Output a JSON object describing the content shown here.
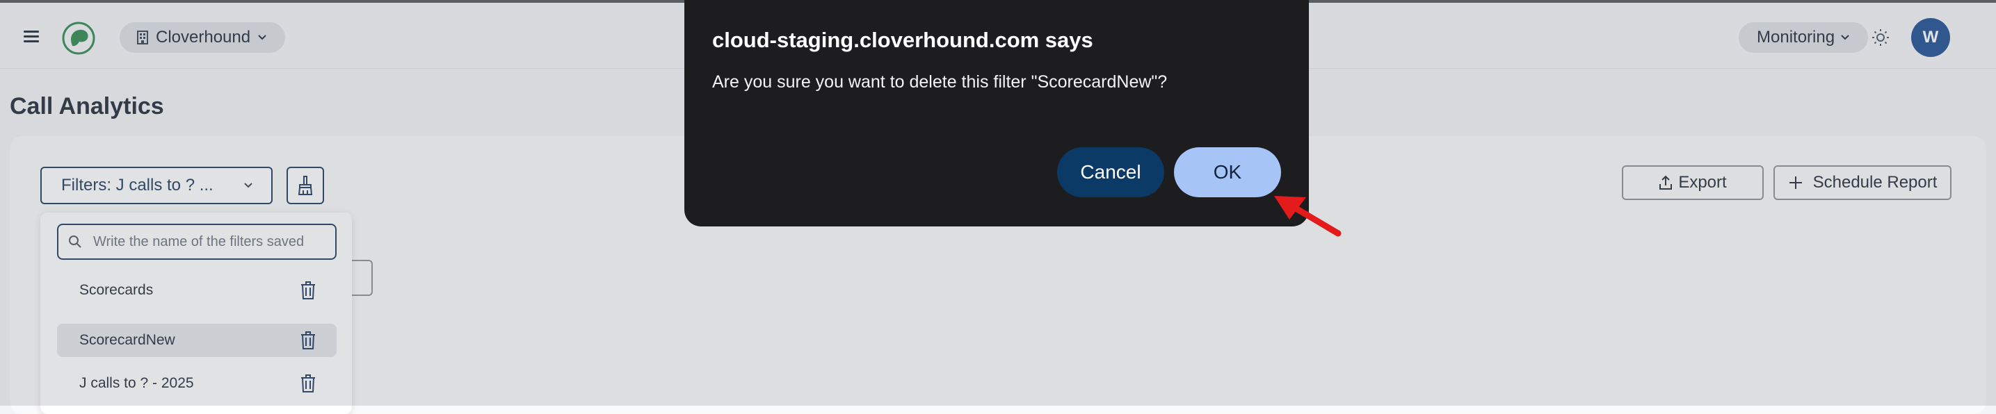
{
  "header": {
    "org_name": "Cloverhound",
    "monitoring_label": "Monitoring",
    "avatar_initial": "W"
  },
  "page": {
    "title": "Call Analytics"
  },
  "filters": {
    "select_label": "Filters: J calls to ? ...",
    "search_placeholder": "Write the name of the filters saved",
    "items": [
      {
        "label": "Scorecards"
      },
      {
        "label": "ScorecardNew"
      },
      {
        "label": "J calls to ? - 2025"
      }
    ]
  },
  "toolbar": {
    "export_label": "Export",
    "schedule_label": "Schedule Report"
  },
  "dialog": {
    "title": "cloud-staging.cloverhound.com says",
    "message": "Are you sure you want to delete this filter \"ScorecardNew\"?",
    "cancel_label": "Cancel",
    "ok_label": "OK"
  },
  "colors": {
    "brand": "#1d4f91",
    "dialog_bg": "#1d1d1f",
    "ok_button": "#a6c4f5",
    "cancel_button": "#0b3a66",
    "annotation_arrow": "#e31b1b"
  },
  "icons": [
    "menu-icon",
    "clover-logo-icon",
    "building-icon",
    "chevron-down-icon",
    "sun-icon",
    "broom-icon",
    "search-icon",
    "trash-icon",
    "upload-icon",
    "plus-icon",
    "red-arrow-annotation"
  ]
}
